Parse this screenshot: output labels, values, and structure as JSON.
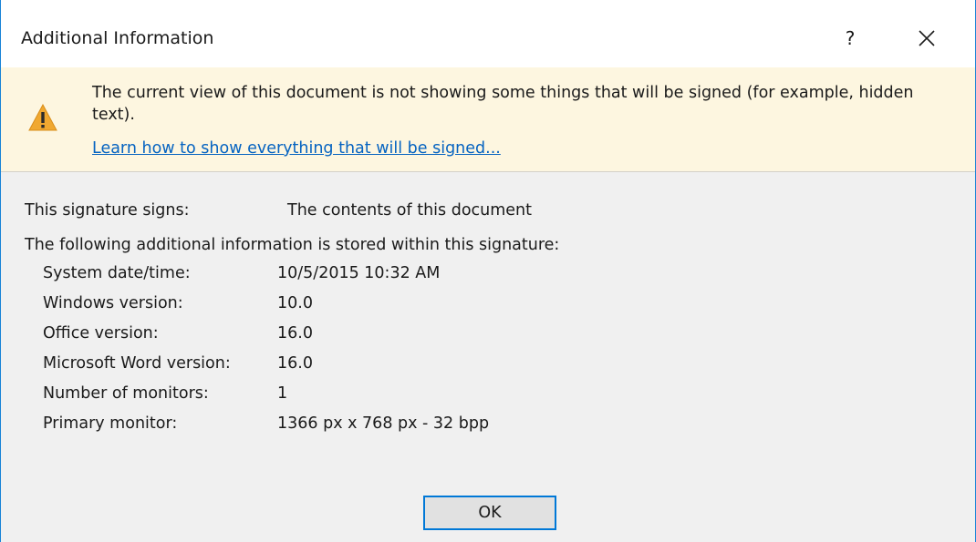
{
  "window": {
    "title": "Additional Information",
    "help_label": "?"
  },
  "infobar": {
    "message": "The current view of this document is not showing some things that will be signed (for example, hidden text).",
    "link": "Learn how to show everything that will be signed..."
  },
  "signature": {
    "signs_label": "This signature signs:",
    "signs_value": "The contents of this document",
    "stored_heading": "The following additional information is stored within this signature:",
    "rows": [
      {
        "label": "System date/time:",
        "value": "10/5/2015 10:32 AM"
      },
      {
        "label": "Windows version:",
        "value": "10.0"
      },
      {
        "label": "Office version:",
        "value": "16.0"
      },
      {
        "label": "Microsoft Word version:",
        "value": "16.0"
      },
      {
        "label": "Number of monitors:",
        "value": "1"
      },
      {
        "label": "Primary monitor:",
        "value": "1366 px x 768 px - 32 bpp"
      }
    ]
  },
  "buttons": {
    "ok": "OK"
  },
  "colors": {
    "accent": "#0078d7",
    "infobar_bg": "#fdf6e0",
    "warning": "#f0a830",
    "link": "#0563c1"
  },
  "icons": [
    "warning-icon",
    "close-icon"
  ]
}
